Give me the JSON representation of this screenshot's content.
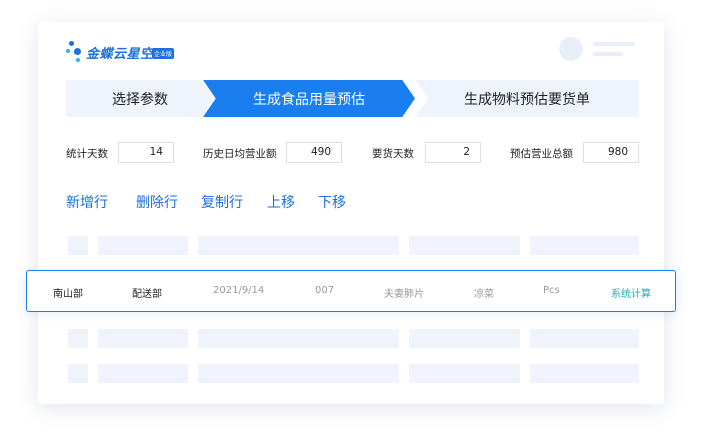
{
  "brand": {
    "name": "金蝶云星空",
    "badge": "企业版",
    "colors": {
      "primary": "#1a7ef0",
      "step_bg": "#eef3fc",
      "accent_green": "#13b5b1"
    }
  },
  "steps": [
    {
      "label": "选择参数",
      "active": false
    },
    {
      "label": "生成食品用量预估",
      "active": true
    },
    {
      "label": "生成物料预估要货单",
      "active": false
    }
  ],
  "params": [
    {
      "label": "统计天数",
      "value": "14"
    },
    {
      "label": "历史日均营业额",
      "value": "490"
    },
    {
      "label": "要货天数",
      "value": "2"
    },
    {
      "label": "预估营业总额",
      "value": "980"
    }
  ],
  "actions": [
    {
      "label": "新增行"
    },
    {
      "label": "删除行"
    },
    {
      "label": "复制行"
    },
    {
      "label": "上移"
    },
    {
      "label": "下移"
    }
  ],
  "highlighted_row": {
    "cells": [
      "南山部",
      "配送部",
      "2021/9/14",
      "007",
      "夫妻肺片",
      "凉菜",
      "Pcs",
      "系统计算"
    ]
  }
}
